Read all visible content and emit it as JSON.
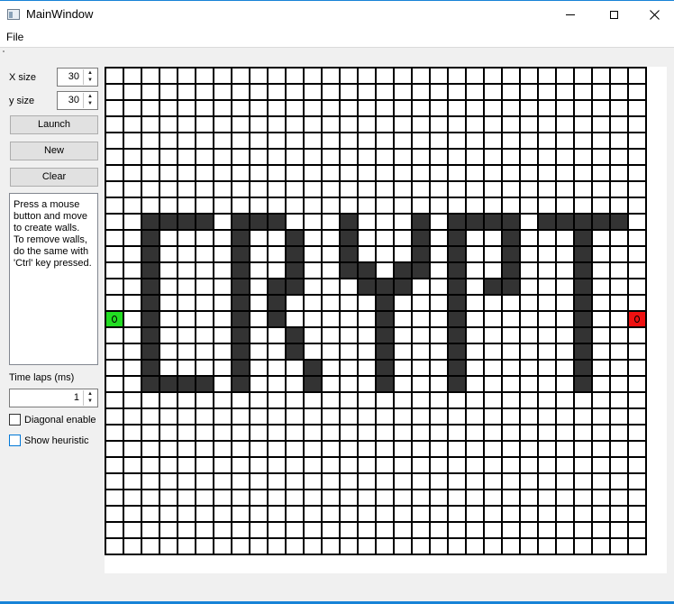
{
  "window": {
    "title": "MainWindow"
  },
  "menu": {
    "file": "File"
  },
  "controls": {
    "x_size_label": "X size",
    "x_size_value": "30",
    "y_size_label": "y size",
    "y_size_value": "30",
    "launch_label": "Launch",
    "new_label": "New",
    "clear_label": "Clear",
    "help_lines": [
      "Press a mouse",
      "button and move",
      "to create walls.",
      "To remove walls,",
      "do the same with",
      "'Ctrl' key pressed."
    ],
    "time_laps_label": "Time laps (ms)",
    "time_laps_value": "1",
    "diagonal_label": "Diagonal enable",
    "diagonal_checked": false,
    "heuristic_label": "Show heuristic",
    "heuristic_checked": false
  },
  "grid": {
    "cols": 30,
    "rows": 30,
    "start": [
      0,
      15
    ],
    "end": [
      29,
      15
    ],
    "walls": [
      [
        2,
        9
      ],
      [
        3,
        9
      ],
      [
        4,
        9
      ],
      [
        5,
        9
      ],
      [
        7,
        9
      ],
      [
        8,
        9
      ],
      [
        9,
        9
      ],
      [
        13,
        9
      ],
      [
        17,
        9
      ],
      [
        19,
        9
      ],
      [
        20,
        9
      ],
      [
        21,
        9
      ],
      [
        22,
        9
      ],
      [
        24,
        9
      ],
      [
        25,
        9
      ],
      [
        26,
        9
      ],
      [
        27,
        9
      ],
      [
        28,
        9
      ],
      [
        2,
        10
      ],
      [
        7,
        10
      ],
      [
        10,
        10
      ],
      [
        13,
        10
      ],
      [
        17,
        10
      ],
      [
        19,
        10
      ],
      [
        22,
        10
      ],
      [
        26,
        10
      ],
      [
        2,
        11
      ],
      [
        7,
        11
      ],
      [
        10,
        11
      ],
      [
        13,
        11
      ],
      [
        17,
        11
      ],
      [
        19,
        11
      ],
      [
        22,
        11
      ],
      [
        26,
        11
      ],
      [
        2,
        12
      ],
      [
        7,
        12
      ],
      [
        10,
        12
      ],
      [
        13,
        12
      ],
      [
        14,
        12
      ],
      [
        16,
        12
      ],
      [
        17,
        12
      ],
      [
        19,
        12
      ],
      [
        22,
        12
      ],
      [
        26,
        12
      ],
      [
        2,
        13
      ],
      [
        7,
        13
      ],
      [
        9,
        13
      ],
      [
        10,
        13
      ],
      [
        14,
        13
      ],
      [
        15,
        13
      ],
      [
        16,
        13
      ],
      [
        19,
        13
      ],
      [
        21,
        13
      ],
      [
        22,
        13
      ],
      [
        26,
        13
      ],
      [
        2,
        14
      ],
      [
        7,
        14
      ],
      [
        9,
        14
      ],
      [
        15,
        14
      ],
      [
        19,
        14
      ],
      [
        26,
        14
      ],
      [
        2,
        15
      ],
      [
        7,
        15
      ],
      [
        9,
        15
      ],
      [
        15,
        15
      ],
      [
        19,
        15
      ],
      [
        26,
        15
      ],
      [
        2,
        16
      ],
      [
        7,
        16
      ],
      [
        10,
        16
      ],
      [
        15,
        16
      ],
      [
        19,
        16
      ],
      [
        26,
        16
      ],
      [
        2,
        17
      ],
      [
        7,
        17
      ],
      [
        10,
        17
      ],
      [
        15,
        17
      ],
      [
        19,
        17
      ],
      [
        26,
        17
      ],
      [
        2,
        18
      ],
      [
        7,
        18
      ],
      [
        11,
        18
      ],
      [
        15,
        18
      ],
      [
        19,
        18
      ],
      [
        26,
        18
      ],
      [
        2,
        19
      ],
      [
        3,
        19
      ],
      [
        4,
        19
      ],
      [
        5,
        19
      ],
      [
        7,
        19
      ],
      [
        11,
        19
      ],
      [
        15,
        19
      ],
      [
        19,
        19
      ],
      [
        26,
        19
      ]
    ]
  },
  "colors": {
    "wall": "#333333",
    "start": "#22dd22",
    "end": "#ee1111",
    "accent": "#1883d7"
  }
}
